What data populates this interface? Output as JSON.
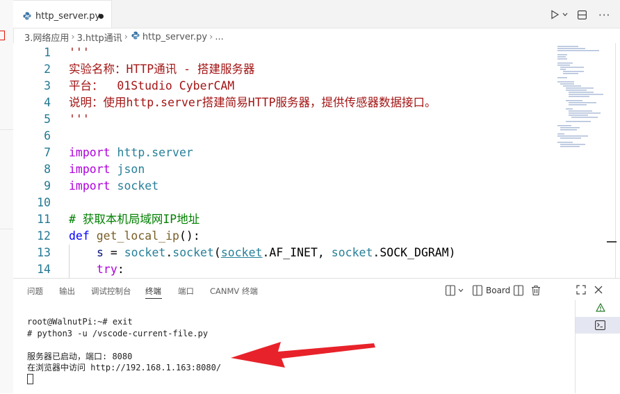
{
  "tab": {
    "filename": "http_server.py"
  },
  "breadcrumb": {
    "part1": "3.网络应用",
    "part2": "3.http通讯",
    "file": "http_server.py",
    "more": "..."
  },
  "editor": {
    "lines": [
      {
        "num": "1"
      },
      {
        "num": "2",
        "text": "实验名称：HTTP通讯 - 搭建服务器"
      },
      {
        "num": "3",
        "text": "平台：  01Studio CyberCAM"
      },
      {
        "num": "4",
        "text": "说明：使用http.server搭建简易HTTP服务器，提供传感器数据接口。"
      },
      {
        "num": "5"
      },
      {
        "num": "6"
      },
      {
        "num": "7",
        "kw": "import",
        "mod": "http.server"
      },
      {
        "num": "8",
        "kw": "import",
        "mod": "json"
      },
      {
        "num": "9",
        "kw": "import",
        "mod": "socket"
      },
      {
        "num": "10"
      },
      {
        "num": "11",
        "text": "# 获取本机局域网IP地址"
      },
      {
        "num": "12",
        "kw": "def",
        "fn": "get_local_ip",
        "tail": "():"
      },
      {
        "num": "13",
        "var": "s",
        "eq": " = ",
        "m1": "socket",
        "dot1": ".",
        "f1": "socket",
        "p1": "(",
        "m2": "socket",
        "c1": ".AF_INET, ",
        "m3": "socket",
        "c2": ".SOCK_DGRAM)"
      },
      {
        "num": "14",
        "kw": "try",
        "tail": ":"
      }
    ],
    "docstring": "'''"
  },
  "panel": {
    "tabs": [
      "问题",
      "输出",
      "调试控制台",
      "终端",
      "端口",
      "CANMV 终端"
    ],
    "active_tab": "终端",
    "board_label": "Board",
    "terminal_lines": [
      "root@WalnutPi:~# exit",
      "# python3 -u /vscode-current-file.py",
      "",
      "服务器已启动，端口: 8080",
      "在浏览器中访问 http://192.168.1.163:8080/"
    ]
  },
  "colors": {
    "arrow": "#e8222a",
    "keyword": "#af00db",
    "module": "#267f99",
    "string": "#a31515",
    "comment": "#008000",
    "line_number": "#237893"
  },
  "icons": [
    "python-file-icon",
    "run-icon",
    "chevron-down-icon",
    "split-editor-icon",
    "more-icon",
    "layout-icon",
    "board-icon",
    "trash-icon",
    "maximize-icon",
    "close-icon",
    "warning-icon",
    "terminal-icon"
  ]
}
